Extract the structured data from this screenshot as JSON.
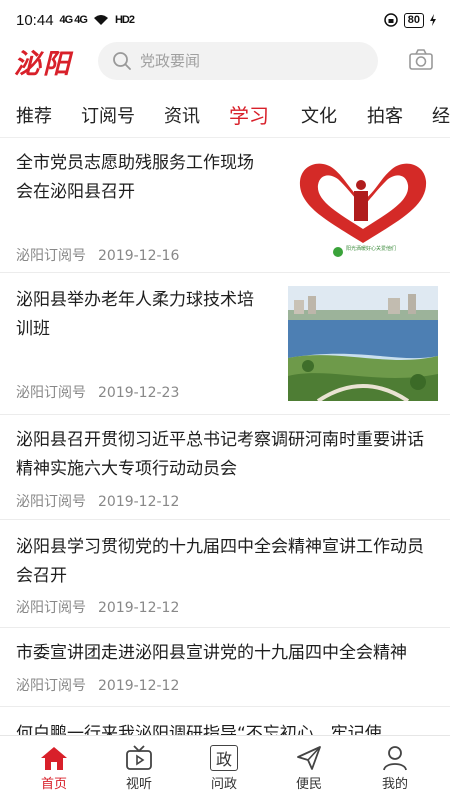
{
  "status_bar": {
    "time": "10:44",
    "signal": "4G 4G",
    "hd": "HD2",
    "battery": "80"
  },
  "header": {
    "logo": "泌阳",
    "search_placeholder": "党政要闻"
  },
  "tabs": [
    {
      "label": "推荐"
    },
    {
      "label": "订阅号"
    },
    {
      "label": "资讯"
    },
    {
      "label": "学习",
      "active": true
    },
    {
      "label": "文化"
    },
    {
      "label": "拍客"
    },
    {
      "label": "经"
    }
  ],
  "news": [
    {
      "title_line1": "全市党员志愿助残服务工作现场",
      "title_line2": "会在泌阳县召开",
      "source": "泌阳订阅号",
      "date": "2019-12-16",
      "thumb_caption": "阳光洒暖好心关爱他们"
    },
    {
      "title_line1": "泌阳县举办老年人柔力球技术培",
      "title_line2": "训班",
      "source": "泌阳订阅号",
      "date": "2019-12-23"
    },
    {
      "title_line1": "泌阳县召开贯彻习近平总书记考察调研河南时重要讲话",
      "title_line2": "精神实施六大专项行动动员会",
      "source": "泌阳订阅号",
      "date": "2019-12-12"
    },
    {
      "title_line1": "泌阳县学习贯彻党的十九届四中全会精神宣讲工作动员",
      "title_line2": "会召开",
      "source": "泌阳订阅号",
      "date": "2019-12-12"
    },
    {
      "title_line1": "市委宣讲团走进泌阳县宣讲党的十九届四中全会精神",
      "source": "泌阳订阅号",
      "date": "2019-12-12"
    },
    {
      "title_line1": "何白鹏一行来我泌阳调研指导“不忘初心、牢记使"
    }
  ],
  "bottom_nav": [
    {
      "label": "首页",
      "icon": "home-icon",
      "active": true
    },
    {
      "label": "视听",
      "icon": "tv-icon"
    },
    {
      "label": "问政",
      "icon": "wenzheng-icon",
      "glyph": "政"
    },
    {
      "label": "便民",
      "icon": "send-icon"
    },
    {
      "label": "我的",
      "icon": "user-icon"
    }
  ],
  "colors": {
    "accent": "#d8202a",
    "text": "#1e1e1e",
    "meta": "#888888"
  }
}
